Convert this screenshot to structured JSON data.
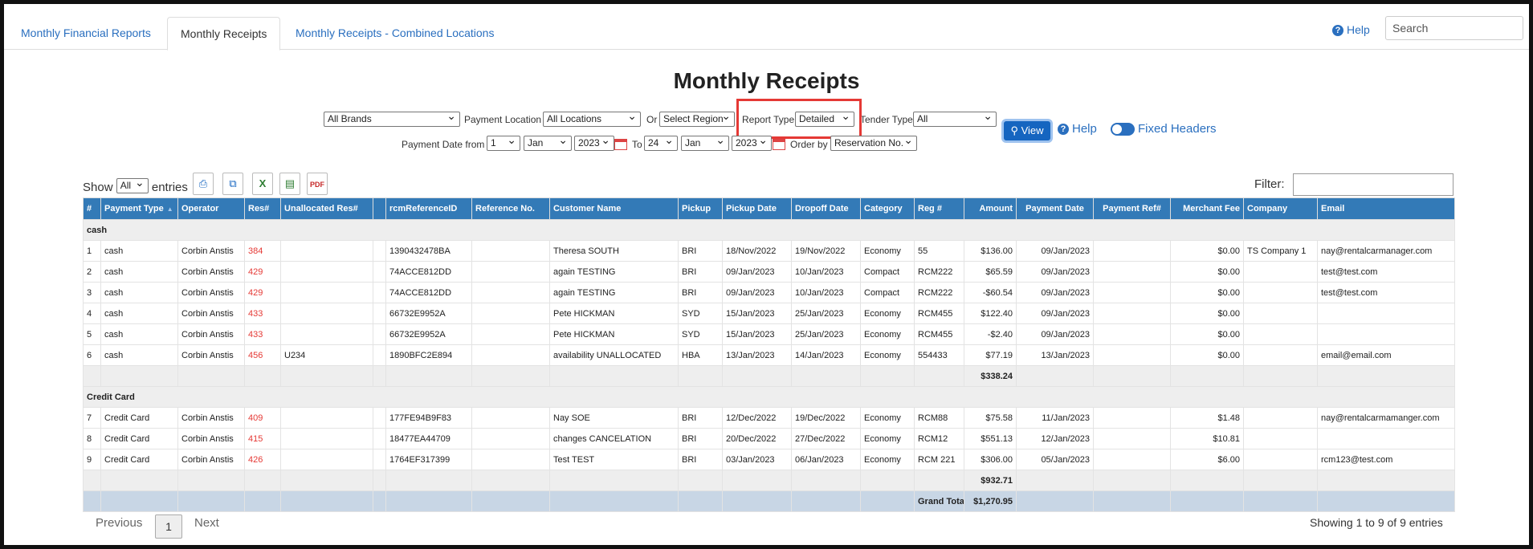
{
  "tabs": [
    "Monthly Financial Reports",
    "Monthly Receipts",
    "Monthly Receipts - Combined Locations"
  ],
  "help_label": "Help",
  "search_placeholder": "Search",
  "title": "Monthly Receipts",
  "filters": {
    "brand": "All Brands",
    "payment_location_label": "Payment Location",
    "payment_location": "All Locations",
    "or_label": "Or",
    "region": "Select Region",
    "report_type_label": "Report Type",
    "report_type": "Detailed",
    "tender_type_label": "Tender Type",
    "tender_type": "All",
    "view_label": "View",
    "help_label": "Help",
    "fixed_headers_label": "Fixed Headers",
    "payment_date_from_label": "Payment Date from",
    "from_day": "1",
    "from_month": "Jan",
    "from_year": "2023",
    "to_label": "To",
    "to_day": "24",
    "to_month": "Jan",
    "to_year": "2023",
    "order_by_label": "Order by",
    "order_by": "Reservation No."
  },
  "table_controls": {
    "show_label": "Show",
    "show_value": "All",
    "entries_label": "entries",
    "filter_label": "Filter:"
  },
  "columns": [
    "#",
    "Payment Type",
    "Operator",
    "Res#",
    "Unallocated Res#",
    "",
    "rcmReferenceID",
    "Reference No.",
    "Customer Name",
    "Pickup",
    "Pickup Date",
    "Dropoff Date",
    "Category",
    "Reg #",
    "Amount",
    "Payment Date",
    "Payment Ref#",
    "Merchant Fee",
    "Company",
    "Email"
  ],
  "groups": [
    {
      "name": "cash",
      "rows": [
        [
          "1",
          "cash",
          "Corbin Anstis",
          "384",
          "",
          "",
          "1390432478BA",
          "",
          "Theresa SOUTH",
          "BRI",
          "18/Nov/2022",
          "19/Nov/2022",
          "Economy",
          "55",
          "$136.00",
          "09/Jan/2023",
          "",
          "$0.00",
          "TS Company 1",
          "nay@rentalcarmanager.com"
        ],
        [
          "2",
          "cash",
          "Corbin Anstis",
          "429",
          "",
          "",
          "74ACCE812DD",
          "",
          "again TESTING",
          "BRI",
          "09/Jan/2023",
          "10/Jan/2023",
          "Compact",
          "RCM222",
          "$65.59",
          "09/Jan/2023",
          "",
          "$0.00",
          "",
          "test@test.com"
        ],
        [
          "3",
          "cash",
          "Corbin Anstis",
          "429",
          "",
          "",
          "74ACCE812DD",
          "",
          "again TESTING",
          "BRI",
          "09/Jan/2023",
          "10/Jan/2023",
          "Compact",
          "RCM222",
          "-$60.54",
          "09/Jan/2023",
          "",
          "$0.00",
          "",
          "test@test.com"
        ],
        [
          "4",
          "cash",
          "Corbin Anstis",
          "433",
          "",
          "",
          "66732E9952A",
          "",
          "Pete HICKMAN",
          "SYD",
          "15/Jan/2023",
          "25/Jan/2023",
          "Economy",
          "RCM455",
          "$122.40",
          "09/Jan/2023",
          "",
          "$0.00",
          "",
          ""
        ],
        [
          "5",
          "cash",
          "Corbin Anstis",
          "433",
          "",
          "",
          "66732E9952A",
          "",
          "Pete HICKMAN",
          "SYD",
          "15/Jan/2023",
          "25/Jan/2023",
          "Economy",
          "RCM455",
          "-$2.40",
          "09/Jan/2023",
          "",
          "$0.00",
          "",
          ""
        ],
        [
          "6",
          "cash",
          "Corbin Anstis",
          "456",
          "U234",
          "",
          "1890BFC2E894",
          "",
          "availability UNALLOCATED",
          "HBA",
          "13/Jan/2023",
          "14/Jan/2023",
          "Economy",
          "554433",
          "$77.19",
          "13/Jan/2023",
          "",
          "$0.00",
          "",
          "email@email.com"
        ]
      ],
      "subtotal": "$338.24"
    },
    {
      "name": "Credit Card",
      "rows": [
        [
          "7",
          "Credit Card",
          "Corbin Anstis",
          "409",
          "",
          "",
          "177FE94B9F83",
          "",
          "Nay SOE",
          "BRI",
          "12/Dec/2022",
          "19/Dec/2022",
          "Economy",
          "RCM88",
          "$75.58",
          "11/Jan/2023",
          "",
          "$1.48",
          "",
          "nay@rentalcarmamanger.com"
        ],
        [
          "8",
          "Credit Card",
          "Corbin Anstis",
          "415",
          "",
          "",
          "18477EA44709",
          "",
          "changes CANCELATION",
          "BRI",
          "20/Dec/2022",
          "27/Dec/2022",
          "Economy",
          "RCM12",
          "$551.13",
          "12/Jan/2023",
          "",
          "$10.81",
          "",
          ""
        ],
        [
          "9",
          "Credit Card",
          "Corbin Anstis",
          "426",
          "",
          "",
          "1764EF317399",
          "",
          "Test TEST",
          "BRI",
          "03/Jan/2023",
          "06/Jan/2023",
          "Economy",
          "RCM 221",
          "$306.00",
          "05/Jan/2023",
          "",
          "$6.00",
          "",
          "rcm123@test.com"
        ]
      ],
      "subtotal": "$932.71"
    }
  ],
  "grand_total_label": "Grand Total",
  "grand_total": "$1,270.95",
  "pager": {
    "previous": "Previous",
    "page": "1",
    "next": "Next"
  },
  "showing": "Showing 1 to 9 of 9 entries",
  "colors": {
    "header_blue": "#337ab7",
    "link_blue": "#2a6fbf",
    "highlight_red": "#e53935"
  }
}
